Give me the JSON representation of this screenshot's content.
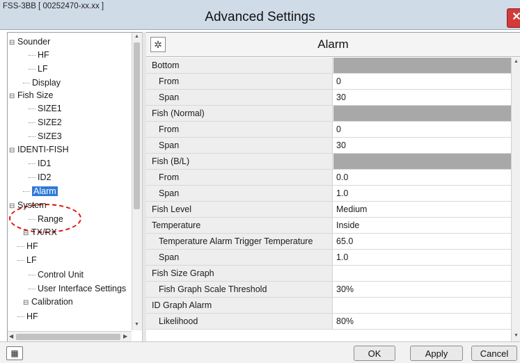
{
  "window": {
    "model_label": "FSS-3BB [ 00252470-xx.xx ]",
    "title": "Advanced Settings",
    "close_glyph": "✕"
  },
  "tree": {
    "nodes": [
      {
        "label": "Sounder",
        "toggle": "⊟"
      },
      {
        "label": "HF"
      },
      {
        "label": "LF"
      },
      {
        "label": "Display"
      },
      {
        "label": "Fish Size",
        "toggle": "⊟"
      },
      {
        "label": "SIZE1"
      },
      {
        "label": "SIZE2"
      },
      {
        "label": "SIZE3"
      },
      {
        "label": "IDENTI-FISH",
        "toggle": "⊟"
      },
      {
        "label": "ID1"
      },
      {
        "label": "ID2"
      },
      {
        "label": "Alarm",
        "selected": true
      },
      {
        "label": "System",
        "toggle": "⊟"
      },
      {
        "label": "Range"
      },
      {
        "label": "TX/RX",
        "toggle": "⊟"
      },
      {
        "label": "HF"
      },
      {
        "label": "LF"
      },
      {
        "label": "Control Unit"
      },
      {
        "label": "User Interface Settings"
      },
      {
        "label": "Calibration",
        "toggle": "⊟"
      },
      {
        "label": "HF"
      }
    ],
    "scroll_up_glyph": "▲",
    "scroll_down_glyph": "▼",
    "scroll_left_glyph": "◀",
    "scroll_right_glyph": "▶"
  },
  "panel": {
    "title": "Alarm",
    "icon": "settings-icon",
    "icon_glyph": "✲",
    "rows": [
      {
        "label": "Bottom",
        "value": "",
        "kind": "group"
      },
      {
        "label": "From",
        "value": "0",
        "kind": "child"
      },
      {
        "label": "Span",
        "value": "30",
        "kind": "child"
      },
      {
        "label": "Fish (Normal)",
        "value": "",
        "kind": "group"
      },
      {
        "label": "From",
        "value": "0",
        "kind": "child"
      },
      {
        "label": "Span",
        "value": "30",
        "kind": "child"
      },
      {
        "label": "Fish (B/L)",
        "value": "",
        "kind": "group"
      },
      {
        "label": "From",
        "value": "0.0",
        "kind": "child"
      },
      {
        "label": "Span",
        "value": "1.0",
        "kind": "child"
      },
      {
        "label": "Fish Level",
        "value": "Medium",
        "kind": "item"
      },
      {
        "label": "Temperature",
        "value": "Inside",
        "kind": "item"
      },
      {
        "label": "Temperature Alarm Trigger Temperature",
        "value": "65.0",
        "kind": "child"
      },
      {
        "label": "Span",
        "value": "1.0",
        "kind": "child"
      },
      {
        "label": "Fish Size Graph",
        "value": "",
        "kind": "section"
      },
      {
        "label": "Fish Graph Scale Threshold",
        "value": "30%",
        "kind": "child"
      },
      {
        "label": "ID Graph Alarm",
        "value": "",
        "kind": "section"
      },
      {
        "label": "Likelihood",
        "value": "80%",
        "kind": "child"
      }
    ]
  },
  "footer": {
    "keyboard_icon": "keyboard-icon",
    "keyboard_glyph": "▦",
    "ok_label": "OK",
    "apply_label": "Apply",
    "cancel_label": "Cancel"
  }
}
